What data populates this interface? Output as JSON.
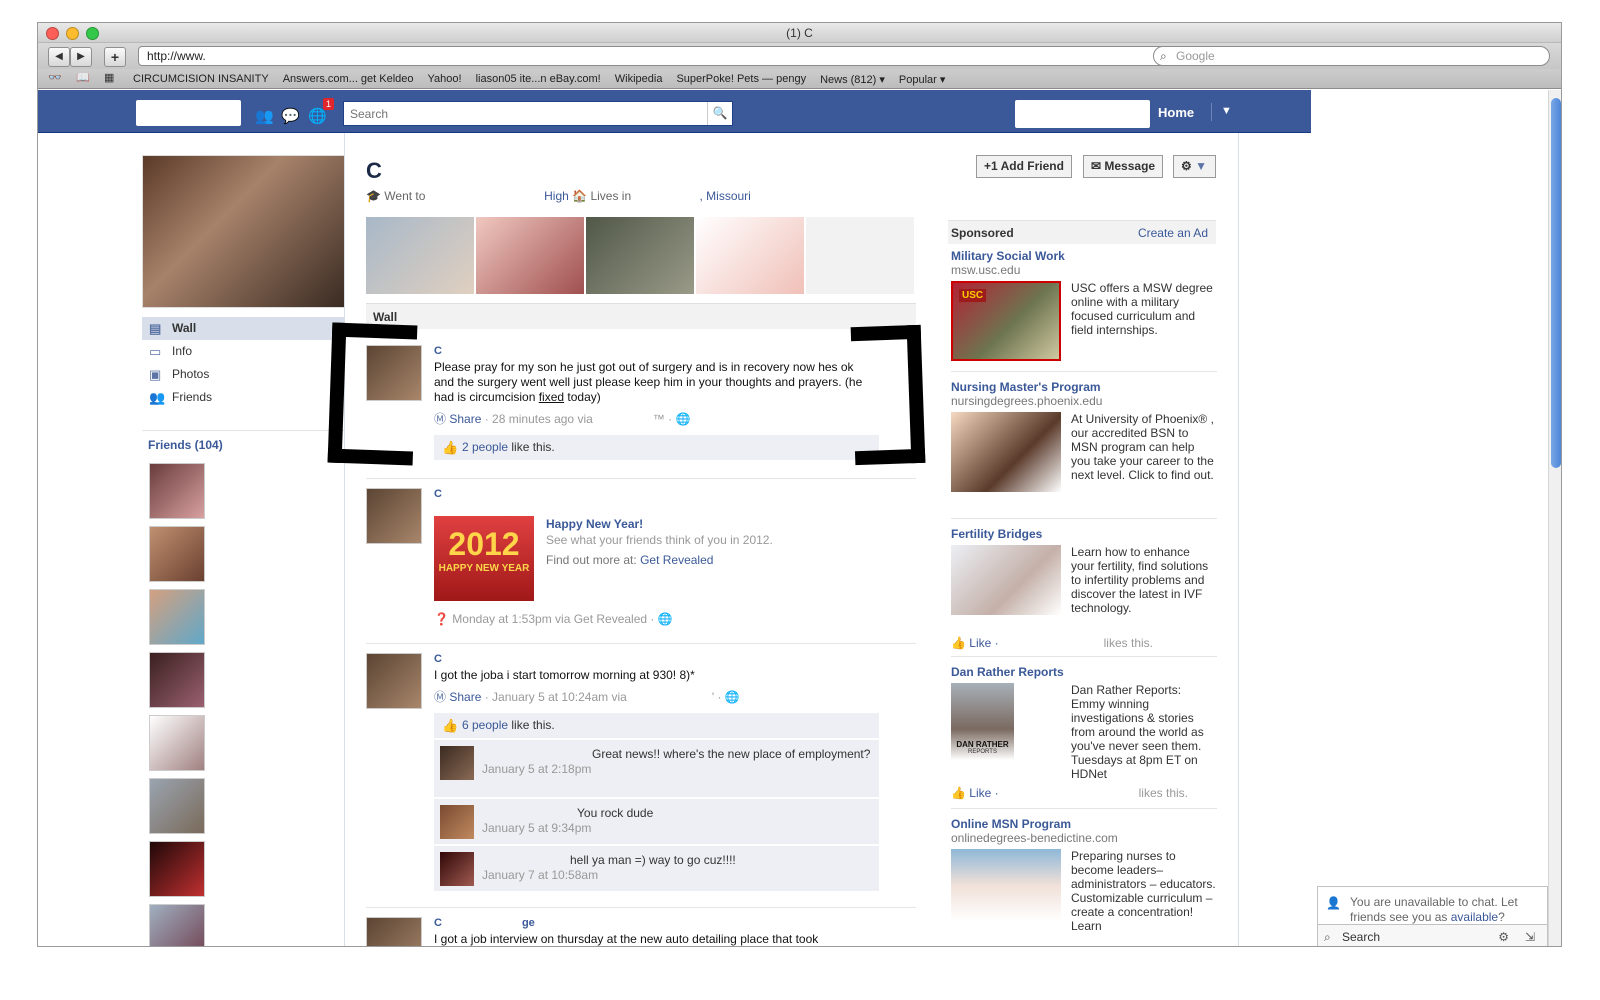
{
  "window": {
    "title": "(1) C"
  },
  "browser": {
    "url": "http://www.",
    "search_placeholder": "Google",
    "bookmarks": [
      "CIRCUMCISION INSANITY",
      "Answers.com... get Keldeo",
      "Yahoo!",
      "liason05 ite...n eBay.com!",
      "Wikipedia",
      "SuperPoke! Pets — pengy",
      "News (812) ▾",
      "Popular ▾"
    ]
  },
  "fbheader": {
    "notif_count": "1",
    "search_placeholder": "Search",
    "home": "Home"
  },
  "profile": {
    "name": "C",
    "went_to": "Went to",
    "school_suffix": "High",
    "lives_in": "Lives in",
    "city_suffix": ", Missouri",
    "add_friend": "Add Friend",
    "message": "Message"
  },
  "leftnav": {
    "items": [
      "Wall",
      "Info",
      "Photos",
      "Friends"
    ],
    "friends_header": "Friends (104)"
  },
  "wall": {
    "header": "Wall",
    "posts": [
      {
        "author": "C",
        "text": "Please pray for my son he just got out of surgery and is in recovery now hes ok and the surgery went well just please keep him in your thoughts and prayers. (he had is circumcision",
        "text_underlined": "fixed",
        "text_end": "today)",
        "share": "Share",
        "meta": " · 28 minutes ago via",
        "tm": "™ ·",
        "likes_link": "2 people",
        "likes_text": " like this."
      },
      {
        "author": "C",
        "app_title": "Happy New Year!",
        "app_desc": "See what your friends think of you in 2012.",
        "find_more": "Find out more at:",
        "find_link": "Get Revealed",
        "img_main": "2012",
        "img_sub": "HAPPY NEW YEAR",
        "meta": "Monday at 1:53pm via Get Revealed ·"
      },
      {
        "author": "C",
        "text": "I got the joba i start tomorrow morning at 930! 8)*",
        "share": "Share",
        "meta": " · January 5 at 10:24am via",
        "meta_end": "' ·",
        "likes_link": "6 people",
        "likes_text": " like this.",
        "comments": [
          {
            "text": "Great news!! where's the new place of employment?",
            "date": "January 5 at 2:18pm"
          },
          {
            "text": "You rock dude",
            "date": "January 5 at 9:34pm"
          },
          {
            "text": "hell ya man =) way to go cuz!!!!",
            "date": "January 7 at 10:58am"
          }
        ]
      },
      {
        "author": "C",
        "author_end": "ge",
        "text": "I got a job interview on thursday at the new auto detailing place that took"
      }
    ]
  },
  "sponsored": {
    "header": "Sponsored",
    "create_ad": "Create an Ad",
    "ads": [
      {
        "title": "Military Social Work",
        "url": "msw.usc.edu",
        "text": "USC offers a MSW degree online with a military focused curriculum and field internships.",
        "img_label": "USC"
      },
      {
        "title": "Nursing Master's Program",
        "url": "nursingdegrees.phoenix.edu",
        "text": "At University of Phoenix® , our accredited BSN to MSN program can help you take your career to the next level. Click to find out."
      },
      {
        "title": "Fertility Bridges",
        "text": "Learn how to enhance your fertility, find solutions to infertility problems and discover the latest in IVF technology.",
        "like": "Like ·",
        "likes_this": "likes this."
      },
      {
        "title": "Dan Rather Reports",
        "text": "Dan Rather Reports: Emmy winning investigations & stories from around the world as you've never seen them. Tuesdays at 8pm ET on HDNet",
        "img_label": "DAN RATHER",
        "img_sub": "REPORTS",
        "like": "Like ·",
        "likes_this": "likes this."
      },
      {
        "title": "Online MSN Program",
        "url": "onlinedegrees-benedictine.com",
        "text": "Preparing nurses to become leaders– administrators – educators. Customizable curriculum – create a concentration! Learn"
      }
    ]
  },
  "chat": {
    "message": "You are unavailable to chat. Let friends see you as",
    "link": "available",
    "end": "?",
    "search": "Search"
  },
  "colors": {
    "fb_blue": "#3b5998",
    "link": "#3b5998",
    "light_bg": "#edeff4"
  }
}
